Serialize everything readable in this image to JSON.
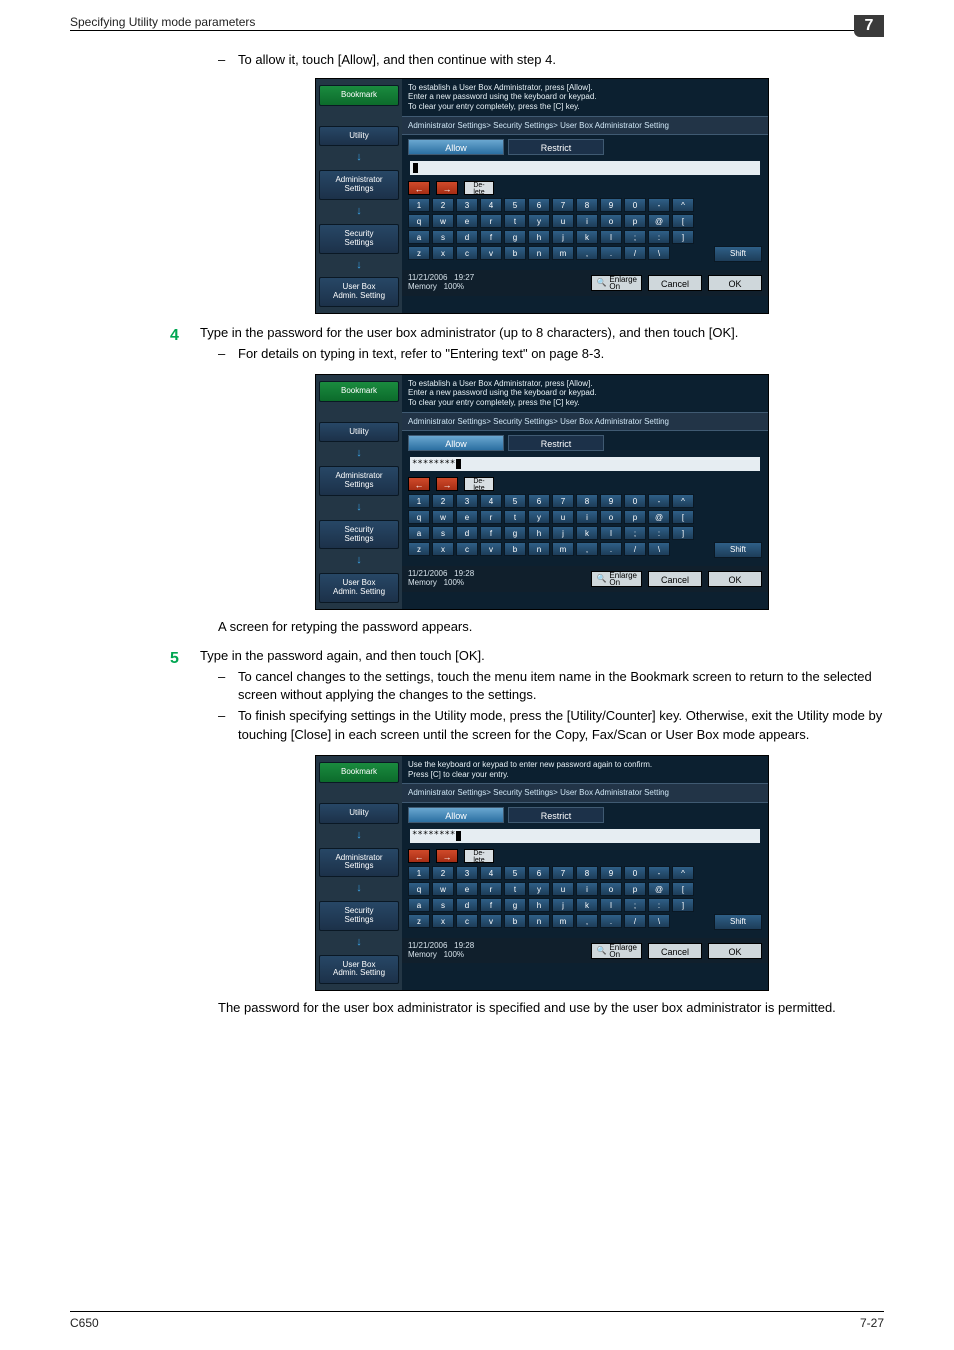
{
  "header": {
    "title": "Specifying Utility mode parameters",
    "chapter_badge": "7"
  },
  "footer": {
    "left": "C650",
    "right": "7-27"
  },
  "body": {
    "bullet_allow": "To allow it, touch [Allow], and then continue with step 4.",
    "step4_num": "4",
    "step4_text": "Type in the password for the user box administrator (up to 8 characters), and then touch [OK].",
    "step4_sub": "For details on typing in text, refer to \"Entering text\" on page 8-3.",
    "after_step4": "A screen for retyping the password appears.",
    "step5_num": "5",
    "step5_text": "Type in the password again, and then touch [OK].",
    "step5_sub1": "To cancel changes to the settings, touch the menu item name in the Bookmark screen to return to the selected screen without applying the changes to the settings.",
    "step5_sub2": "To finish specifying settings in the Utility mode, press the [Utility/Counter] key. Otherwise, exit the Utility mode by touching [Close] in each screen until the screen for the Copy, Fax/Scan or User Box mode appears.",
    "closing": "The password for the user box administrator is specified and use by the user box administrator is permitted."
  },
  "sidebar": {
    "bookmark": "Bookmark",
    "utility": "Utility",
    "admin": "Administrator\nSettings",
    "security": "Security\nSettings",
    "userbox": "User Box\nAdmin. Setting"
  },
  "screens": {
    "instr_new": "To establish a User Box Administrator, press [Allow].\nEnter a new password using the keyboard or keypad.\nTo clear your entry completely, press the [C] key.",
    "instr_confirm": "Use the keyboard or keypad to enter new password again to confirm.\nPress [C] to clear your entry.",
    "breadcrumb": "Administrator Settings> Security Settings> User Box Administrator Setting",
    "tab_allow": "Allow",
    "tab_restrict": "Restrict",
    "delete": "De-\nlete",
    "shift": "Shift",
    "enlarge": "Enlarge\nOn",
    "cancel": "Cancel",
    "ok": "OK",
    "s1": {
      "date": "11/21/2006",
      "time": "19:27",
      "mem_label": "Memory",
      "mem_val": "100%",
      "input": ""
    },
    "s2": {
      "date": "11/21/2006",
      "time": "19:28",
      "mem_label": "Memory",
      "mem_val": "100%",
      "input": "********"
    },
    "s3": {
      "date": "11/21/2006",
      "time": "19:28",
      "mem_label": "Memory",
      "mem_val": "100%",
      "input": "********"
    },
    "row_num": [
      "1",
      "2",
      "3",
      "4",
      "5",
      "6",
      "7",
      "8",
      "9",
      "0",
      "-",
      "^"
    ],
    "row_q": [
      "q",
      "w",
      "e",
      "r",
      "t",
      "y",
      "u",
      "i",
      "o",
      "p",
      "@",
      "["
    ],
    "row_a": [
      "a",
      "s",
      "d",
      "f",
      "g",
      "h",
      "j",
      "k",
      "l",
      ";",
      ":",
      "]"
    ],
    "row_z": [
      "z",
      "x",
      "c",
      "v",
      "b",
      "n",
      "m",
      ",",
      ".",
      "/",
      "\\"
    ]
  }
}
